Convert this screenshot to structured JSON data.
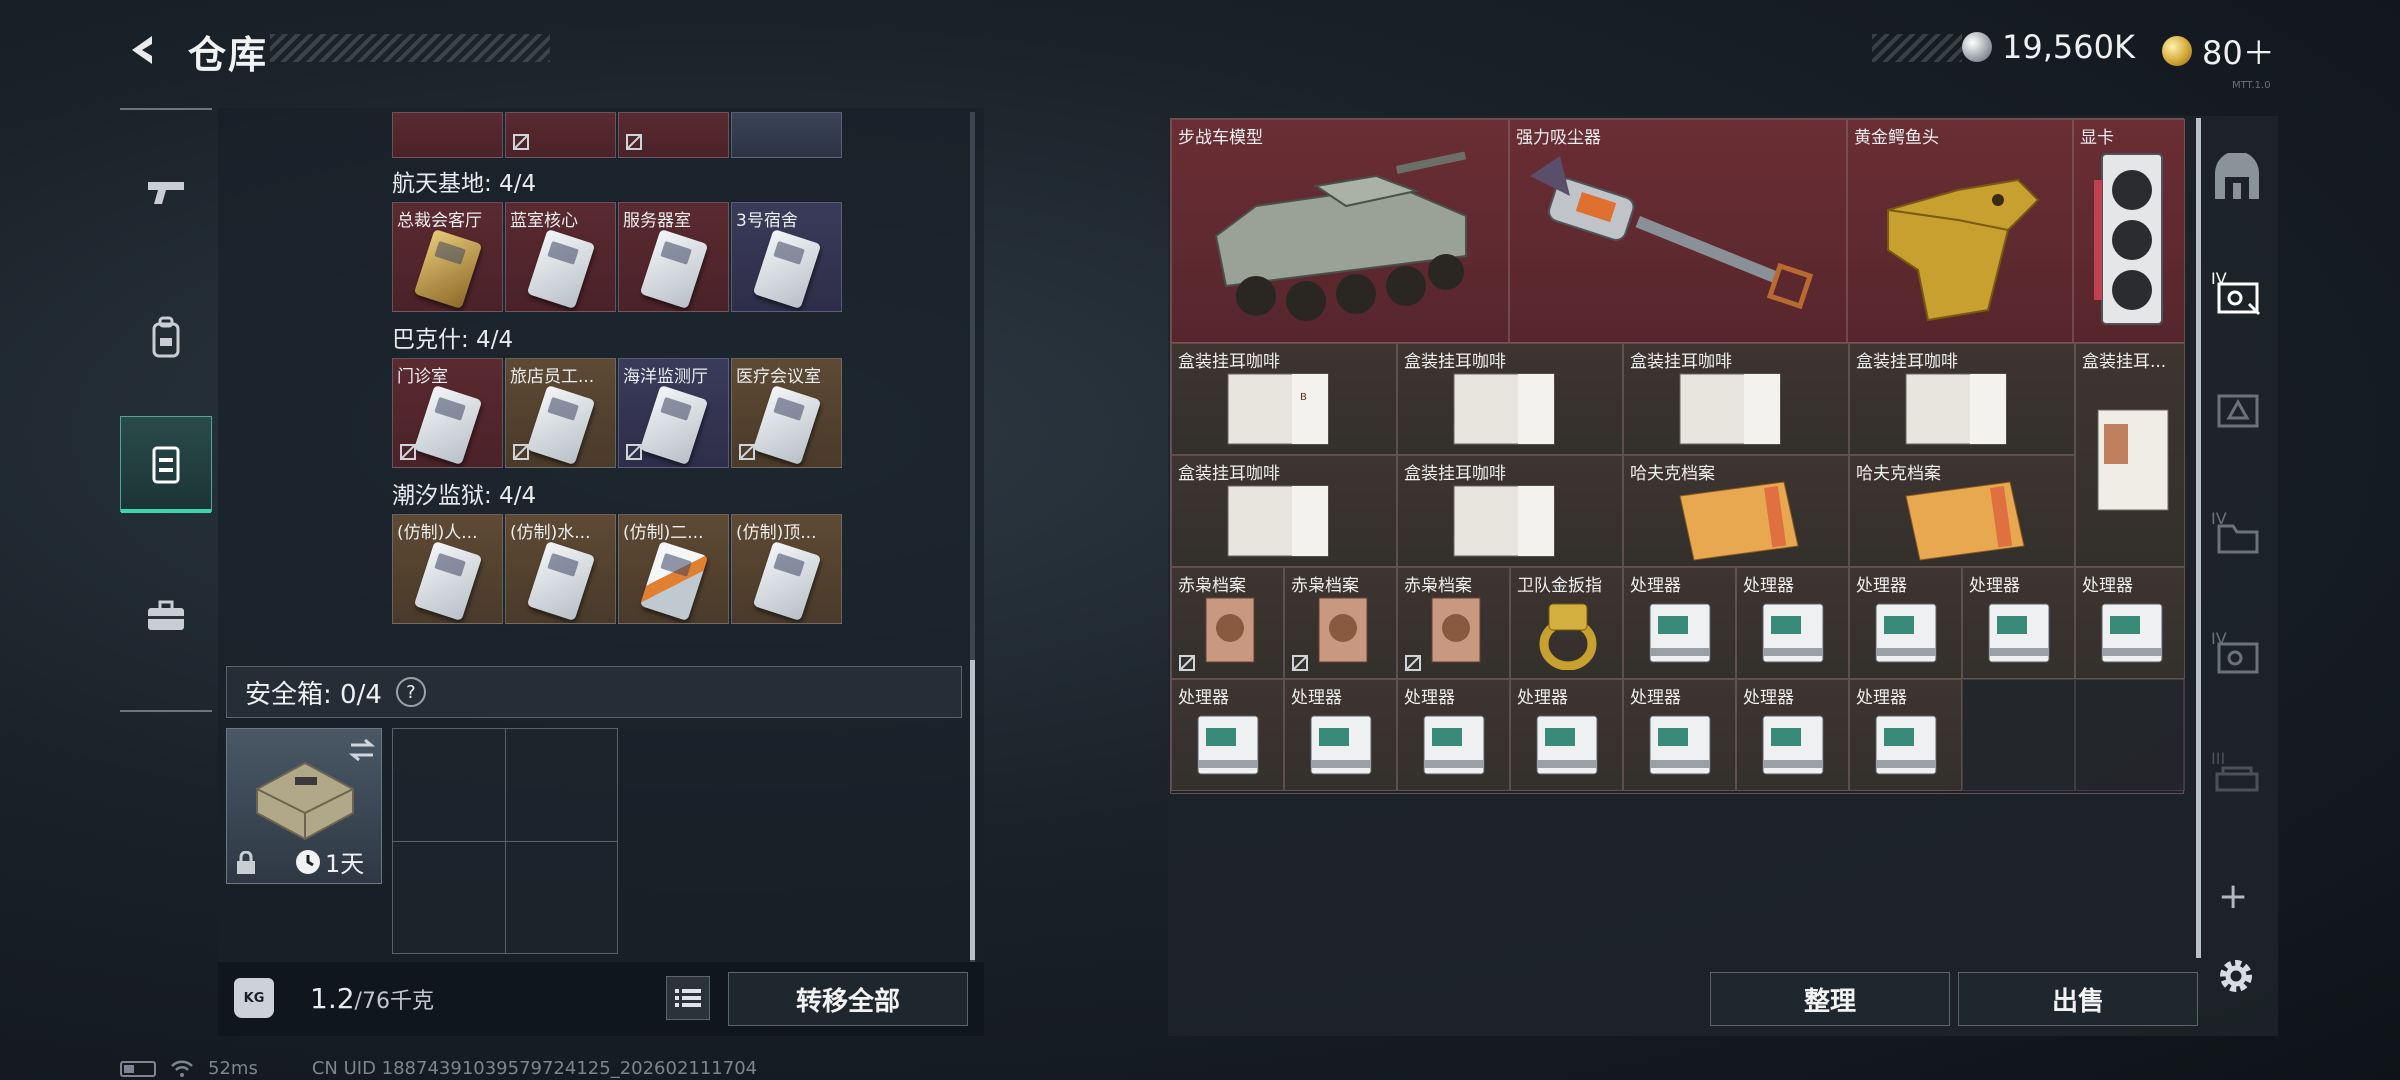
{
  "header": {
    "title": "仓库"
  },
  "currency": {
    "silver": "19,560K",
    "gold": "80＋"
  },
  "left_panel": {
    "sections": [
      {
        "label": "航天基地: 4/4",
        "items": [
          {
            "name": "总裁会客厅",
            "bg": "red"
          },
          {
            "name": "蓝室核心",
            "bg": "red"
          },
          {
            "name": "服务器室",
            "bg": "red"
          },
          {
            "name": "3号宿舍",
            "bg": "purple"
          }
        ]
      },
      {
        "label": "巴克什: 4/4",
        "items": [
          {
            "name": "门诊室",
            "bg": "red"
          },
          {
            "name": "旅店员工...",
            "bg": "gold"
          },
          {
            "name": "海洋监测厅",
            "bg": "purple"
          },
          {
            "name": "医疗会议室",
            "bg": "gold"
          }
        ]
      },
      {
        "label": "潮汐监狱: 4/4",
        "items": [
          {
            "name": "(仿制)人...",
            "bg": "gold"
          },
          {
            "name": "(仿制)水...",
            "bg": "gold"
          },
          {
            "name": "(仿制)二...",
            "bg": "gold"
          },
          {
            "name": "(仿制)顶...",
            "bg": "gold"
          }
        ]
      }
    ],
    "safe_box": {
      "label": "安全箱: 0/4",
      "help": "?",
      "duration": "1天"
    },
    "weight": {
      "current": "1.2",
      "max": "/76千克",
      "icon_text": "KG"
    },
    "transfer_all": "转移全部"
  },
  "grid_items": {
    "row1": [
      {
        "name": "步战车模型"
      },
      {
        "name": "强力吸尘器"
      },
      {
        "name": "黄金鳄鱼头"
      },
      {
        "name": "显卡"
      }
    ],
    "row2": [
      "盒装挂耳咖啡",
      "盒装挂耳咖啡",
      "盒装挂耳咖啡",
      "盒装挂耳咖啡",
      "盒装挂耳..."
    ],
    "row3": [
      "盒装挂耳咖啡",
      "盒装挂耳咖啡",
      "哈夫克档案",
      "哈夫克档案"
    ],
    "row4": [
      "赤枭档案",
      "赤枭档案",
      "赤枭档案",
      "卫队金扳指",
      "处理器",
      "处理器",
      "处理器",
      "处理器",
      "处理器"
    ],
    "row5": [
      "处理器",
      "处理器",
      "处理器",
      "处理器",
      "处理器",
      "处理器",
      "处理器"
    ]
  },
  "buttons": {
    "sort": "整理",
    "sell": "出售"
  },
  "status": {
    "ping": "52ms",
    "uid": "CN UID 18874391039579724125_202602111704"
  },
  "version_mark": "MTT.1.0"
}
